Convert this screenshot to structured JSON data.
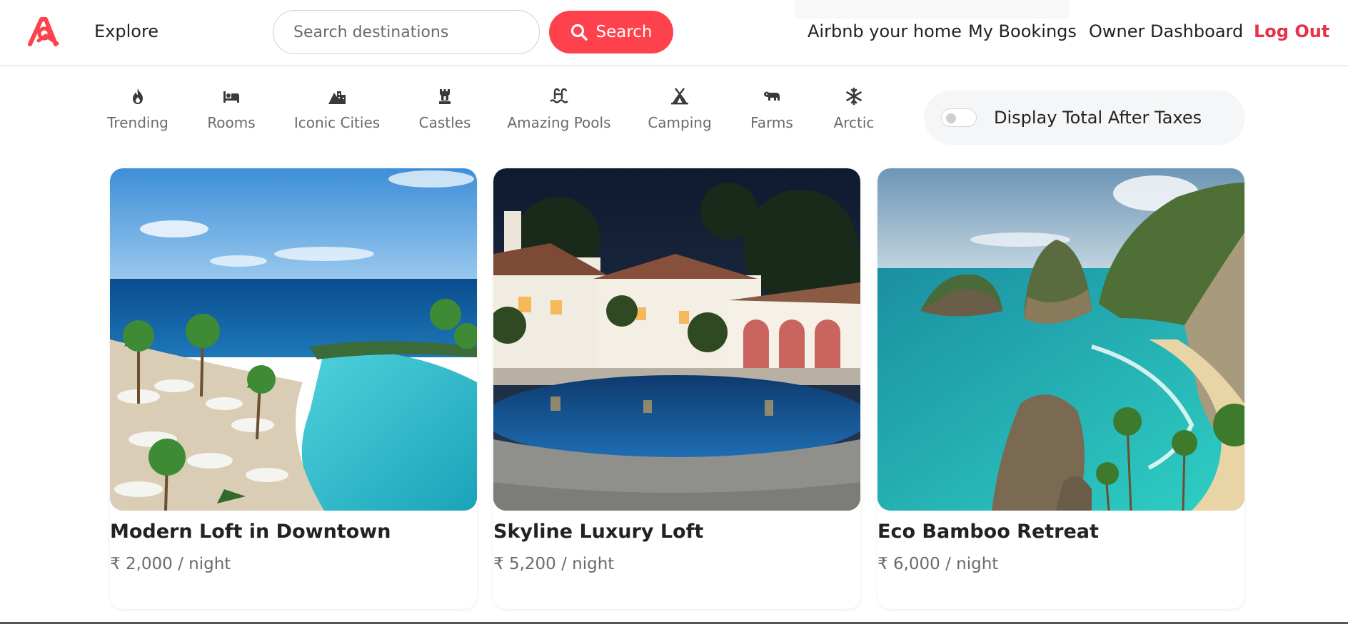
{
  "header": {
    "explore_label": "Explore",
    "search": {
      "placeholder": "Search destinations",
      "value": "",
      "button_label": "Search"
    },
    "links": [
      {
        "label": "Airbnb your home"
      },
      {
        "label": "My Bookings"
      },
      {
        "label": "Owner Dashboard"
      },
      {
        "label": "Log Out"
      }
    ]
  },
  "filters": [
    {
      "label": "Trending",
      "icon": "fire-icon"
    },
    {
      "label": "Rooms",
      "icon": "bed-icon"
    },
    {
      "label": "Iconic Cities",
      "icon": "mountain-city-icon"
    },
    {
      "label": "Castles",
      "icon": "castle-icon"
    },
    {
      "label": "Amazing Pools",
      "icon": "pool-icon"
    },
    {
      "label": "Camping",
      "icon": "campground-icon"
    },
    {
      "label": "Farms",
      "icon": "cow-icon"
    },
    {
      "label": "Arctic",
      "icon": "snowflake-icon"
    }
  ],
  "tax_toggle": {
    "label": "Display Total After Taxes",
    "checked": false
  },
  "listings": [
    {
      "title": "Modern Loft in Downtown",
      "price": "₹ 2,000 / night"
    },
    {
      "title": "Skyline Luxury Loft",
      "price": "₹ 5,200 / night"
    },
    {
      "title": "Eco Bamboo Retreat",
      "price": "₹ 6,000 / night"
    }
  ],
  "colors": {
    "brand": "#fe424d",
    "logout": "#e8304a",
    "text": "#222222",
    "muted": "#6a6a6a"
  }
}
